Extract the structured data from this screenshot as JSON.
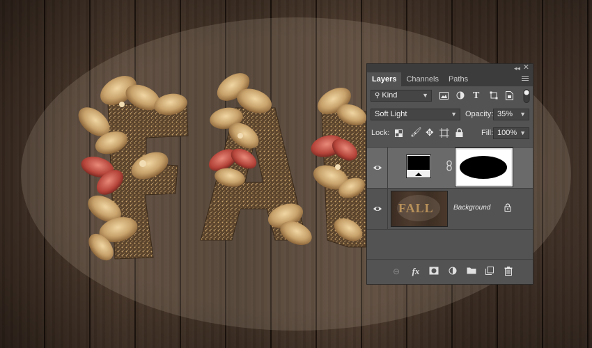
{
  "panel": {
    "tabs": [
      {
        "label": "Layers",
        "active": true
      },
      {
        "label": "Channels",
        "active": false
      },
      {
        "label": "Paths",
        "active": false
      }
    ],
    "filter_kind": "Kind",
    "blend_mode": "Soft Light",
    "opacity_label": "Opacity:",
    "opacity_value": "35%",
    "lock_label": "Lock:",
    "fill_label": "Fill:",
    "fill_value": "100%",
    "layers": [
      {
        "name": "",
        "visible": true,
        "selected": true,
        "has_mask": true
      },
      {
        "name": "Background",
        "visible": true,
        "selected": false,
        "locked": true
      }
    ],
    "thumb_text": "FALL"
  },
  "canvas": {
    "accent_gold": "#b8915a",
    "leaf_red": "#b5443a",
    "wood": "#3e2f24"
  }
}
